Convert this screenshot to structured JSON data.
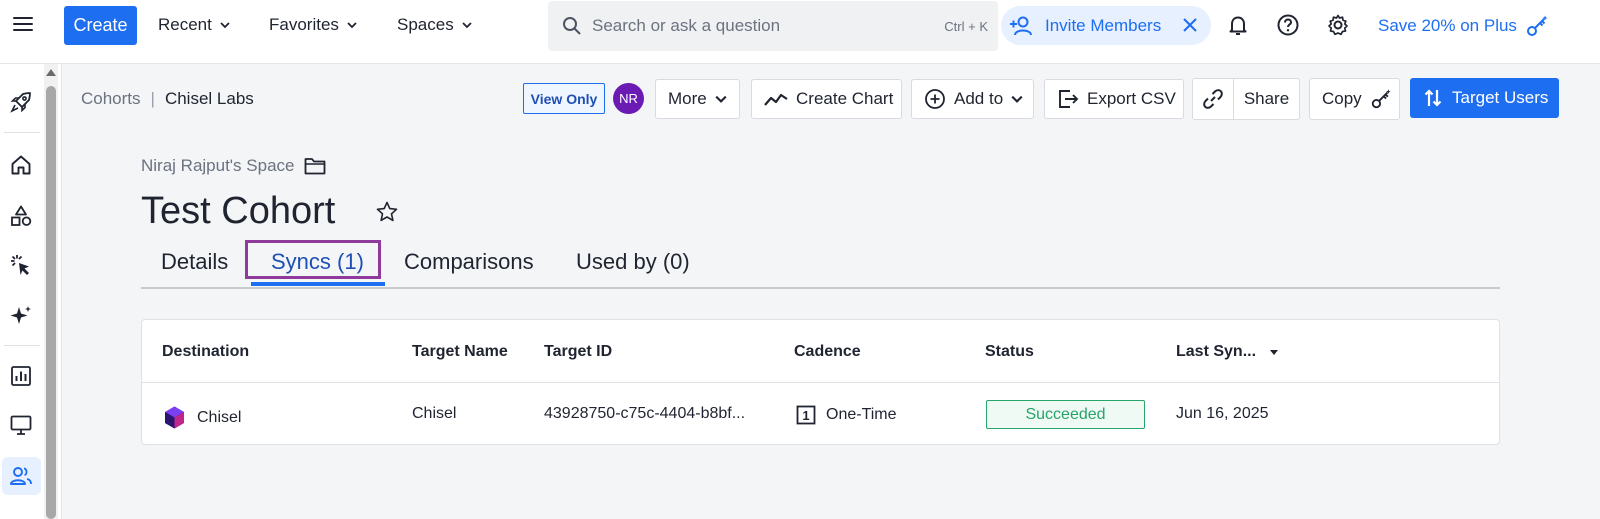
{
  "topbar": {
    "create_label": "Create",
    "nav": [
      {
        "label": "Recent"
      },
      {
        "label": "Favorites"
      },
      {
        "label": "Spaces"
      }
    ],
    "search_placeholder": "Search or ask a question",
    "search_shortcut": "Ctrl + K",
    "invite_label": "Invite Members",
    "promo_label": "Save 20% on Plus"
  },
  "sidebar": {
    "icons": [
      "rocket-icon",
      "home-icon",
      "shapes-icon",
      "cursor-click-icon",
      "sparkle-icon",
      "report-icon",
      "monitor-icon",
      "users-icon"
    ],
    "active": "users-icon"
  },
  "breadcrumb": {
    "parent": "Cohorts",
    "separator": "|",
    "current": "Chisel Labs"
  },
  "header": {
    "view_only": "View Only",
    "avatar_initials": "NR",
    "more_label": "More",
    "create_chart_label": "Create Chart",
    "add_to_label": "Add to",
    "export_csv_label": "Export CSV",
    "share_label": "Share",
    "copy_label": "Copy",
    "target_users_label": "Target Users"
  },
  "page": {
    "space_name": "Niraj Rajput's Space",
    "title": "Test Cohort",
    "tabs": [
      {
        "label": "Details"
      },
      {
        "label": "Syncs (1)",
        "active": true
      },
      {
        "label": "Comparisons"
      },
      {
        "label": "Used by (0)"
      }
    ]
  },
  "table": {
    "columns": [
      "Destination",
      "Target Name",
      "Target ID",
      "Cadence",
      "Status",
      "Last Syn..."
    ],
    "rows": [
      {
        "destination": "Chisel",
        "target_name": "Chisel",
        "target_id": "43928750-c75c-4404-b8bf...",
        "cadence_icon_text": "1",
        "cadence": "One-Time",
        "status": "Succeeded",
        "last_sync": "Jun 16, 2025"
      }
    ]
  },
  "colors": {
    "accent": "#1e6ef2",
    "success": "#27a36c",
    "avatar": "#6b1bb3",
    "tab_highlight": "#8e3b9c"
  }
}
